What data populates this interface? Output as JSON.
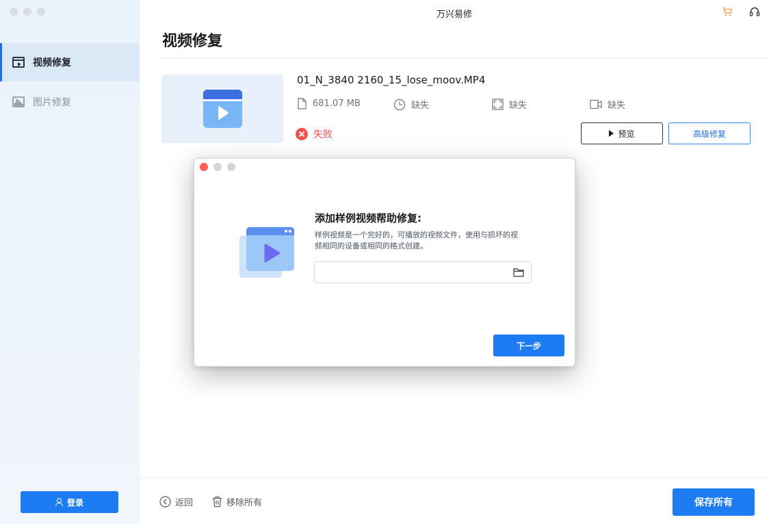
{
  "window": {
    "app_title": "万兴易修"
  },
  "sidebar": {
    "items": [
      {
        "label": "视频修复",
        "icon": "video-icon",
        "active": true
      },
      {
        "label": "图片修复",
        "icon": "image-icon",
        "active": false
      }
    ],
    "login_label": "登录"
  },
  "header": {
    "page_title": "视频修复"
  },
  "file": {
    "name": "01_N_3840 2160_15_lose_moov.MP4",
    "size": "681.07 MB",
    "duration": "缺失",
    "resolution": "缺失",
    "camera": "缺失",
    "status": "失败",
    "preview_label": "预览",
    "advanced_label": "高级修复"
  },
  "footer": {
    "back_label": "返回",
    "remove_all_label": "移除所有",
    "save_all_label": "保存所有"
  },
  "dialog": {
    "heading": "添加样例视频帮助修复:",
    "description": "样例视频是一个完好的，可播放的视频文件，使用与损坏的视频相同的设备或相同的格式创建。",
    "input_value": "",
    "next_label": "下一步"
  },
  "colors": {
    "accent": "#1e7cf2",
    "error": "#ef5350",
    "sidebar_bg": "#eaf2fb",
    "cart": "#f29b38"
  }
}
